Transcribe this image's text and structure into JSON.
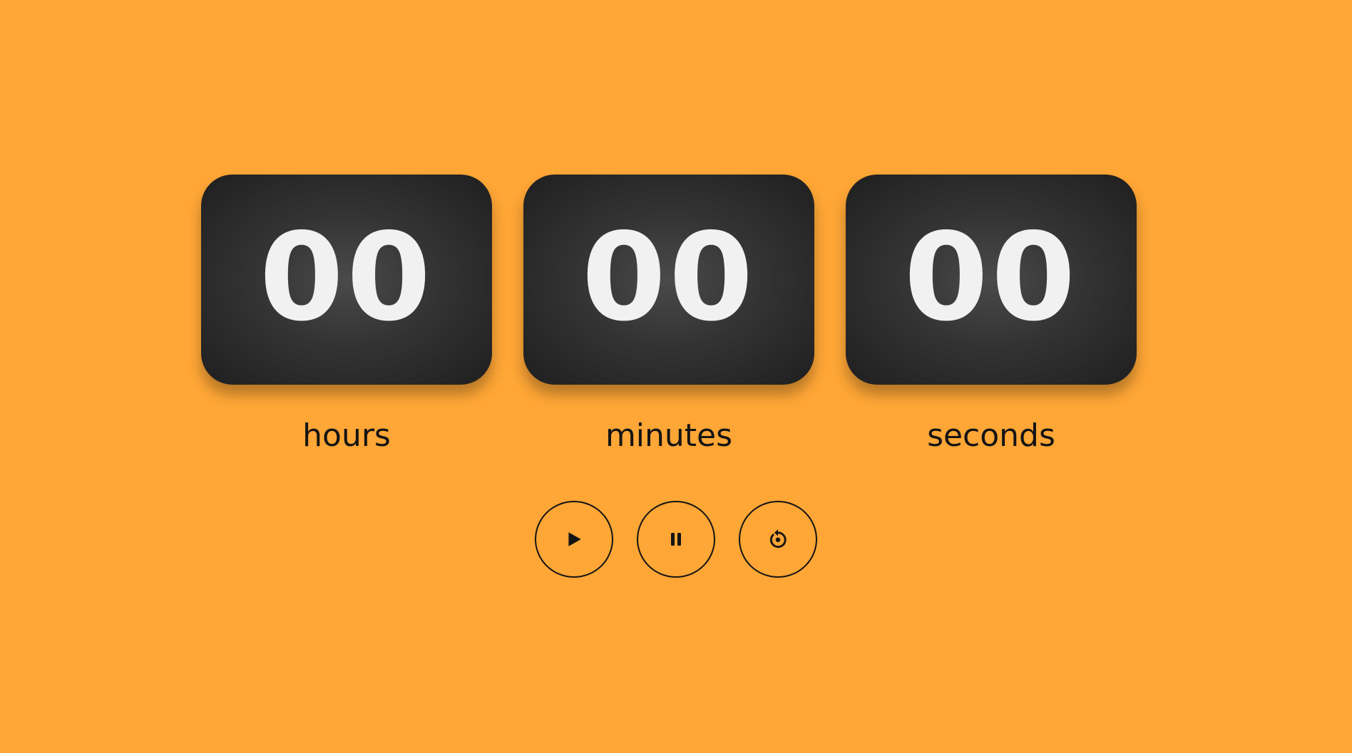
{
  "timer": {
    "hours": {
      "value": "00",
      "label": "hours"
    },
    "minutes": {
      "value": "00",
      "label": "minutes"
    },
    "seconds": {
      "value": "00",
      "label": "seconds"
    }
  },
  "controls": {
    "play": {
      "icon": "play-icon"
    },
    "pause": {
      "icon": "pause-icon"
    },
    "reset": {
      "icon": "reset-icon"
    }
  },
  "colors": {
    "background": "#FEA636",
    "card": "#2e2e2e",
    "digits": "#F1F1F1",
    "text": "#141414"
  }
}
